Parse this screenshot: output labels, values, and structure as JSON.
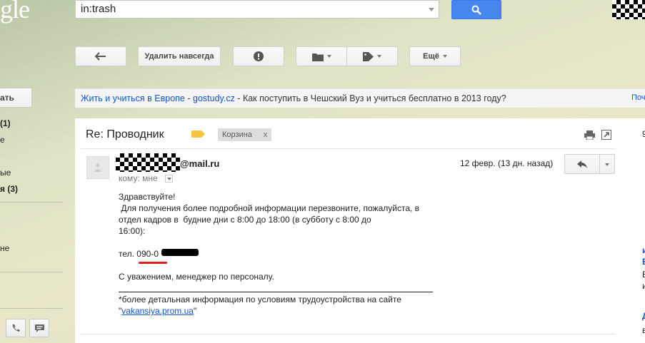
{
  "logo": "gle",
  "search": {
    "value": "in:trash"
  },
  "toolbar": {
    "delete_forever": "Удалить навсегда",
    "more": "Ещё"
  },
  "nav": {
    "compose": "ать",
    "items": [
      {
        "label": "(1)",
        "top": true
      },
      {
        "label": "е"
      },
      {
        "label": "ые"
      },
      {
        "label": "я (3)"
      },
      {
        "label": "не"
      }
    ]
  },
  "ad": {
    "link1": "Жить и учиться в Европе",
    "sep1": " - ",
    "link2": "gostudy.cz",
    "sep2": " - ",
    "text": "Как поступить в Чешский Вуз и учиться бесплатно в 2013 году?",
    "right": "Почт"
  },
  "message": {
    "subject": "Re: Проводник",
    "label": "Корзина",
    "label_close": "x",
    "sender_domain": "@mail.ru",
    "to": "кому: мне",
    "date": "12 февр. (13 дн. назад)",
    "body": {
      "greeting": "Здравствуйте!",
      "line1": " Для получения более подробной информации перезвоните, пожалуйста, в",
      "line2": "отдел кадров в  будние дни с 8:00 до 18:00 (в субботу с 8:00 до",
      "line3": "16:00):",
      "phone": "тел. 090-0",
      "regards": "С уважением, менеджер по персоналу.",
      "footer": "*более детальная информация по условиям трудоустройства на сайте",
      "quote_open": "\"",
      "site": "vakansiya.prom.ua",
      "quote_close": "\""
    }
  },
  "right_column": {
    "frag1": "9",
    "frag2": "и",
    "frag3": "Е",
    "frag4": "В",
    "frag5": "и",
    "frag6": "Д",
    "frag7": "в"
  }
}
